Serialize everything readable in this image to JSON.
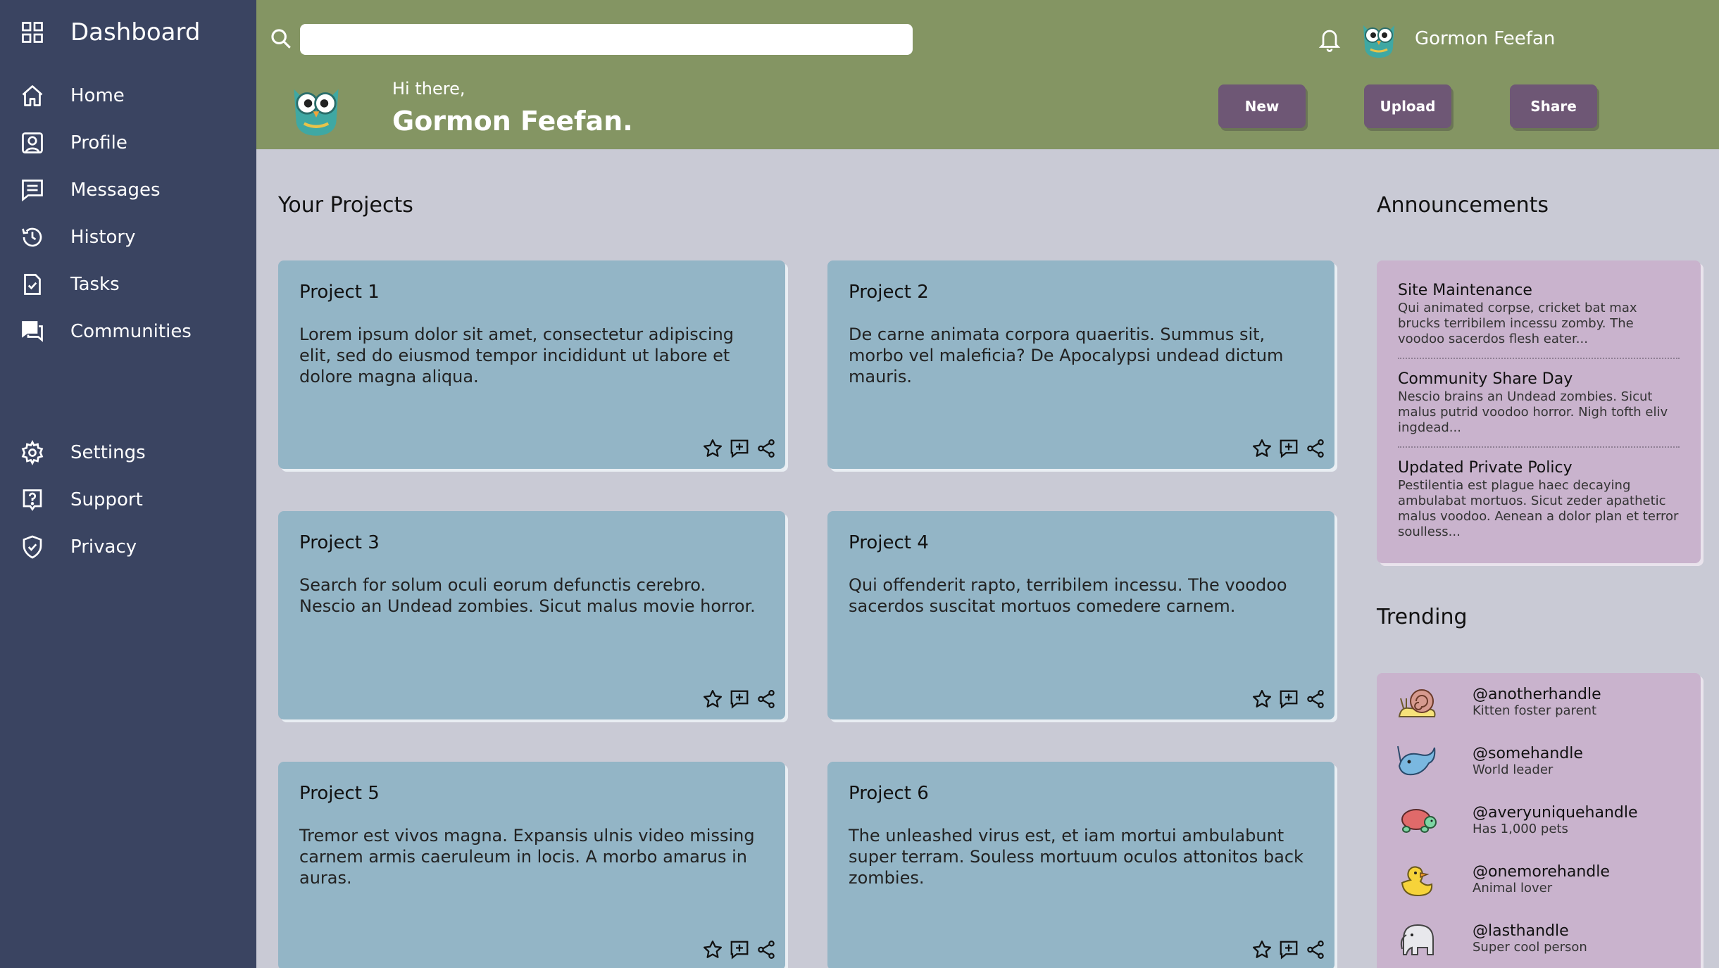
{
  "sidebar": {
    "brand": "Dashboard",
    "items": [
      {
        "label": "Home"
      },
      {
        "label": "Profile"
      },
      {
        "label": "Messages"
      },
      {
        "label": "History"
      },
      {
        "label": "Tasks"
      },
      {
        "label": "Communities"
      },
      {
        "label": "Settings"
      },
      {
        "label": "Support"
      },
      {
        "label": "Privacy"
      }
    ]
  },
  "header": {
    "search_placeholder": "",
    "username": "Gormon Feefan",
    "greeting": "Hi there,",
    "name": "Gormon Feefan.",
    "buttons": {
      "new": "New",
      "upload": "Upload",
      "share": "Share"
    }
  },
  "main": {
    "projects_title": "Your Projects",
    "projects": [
      {
        "title": "Project 1",
        "body": "Lorem ipsum dolor sit amet, consectetur adipiscing elit, sed do eiusmod tempor incididunt ut labore et dolore magna aliqua."
      },
      {
        "title": "Project 2",
        "body": "De carne animata corpora quaeritis. Summus sit, morbo vel maleficia? De Apocalypsi undead dictum mauris."
      },
      {
        "title": "Project 3",
        "body": "Search for solum oculi eorum defunctis cerebro. Nescio an Undead zombies. Sicut malus movie horror."
      },
      {
        "title": "Project 4",
        "body": "Qui offenderit rapto, terribilem incessu. The voodoo sacerdos suscitat mortuos comedere carnem."
      },
      {
        "title": "Project 5",
        "body": "Tremor est vivos magna. Expansis ulnis video missing carnem armis caeruleum in locis. A morbo amarus in auras."
      },
      {
        "title": "Project 6",
        "body": "The unleashed virus est, et iam mortui ambulabunt super terram. Souless mortuum oculos attonitos back zombies."
      }
    ]
  },
  "announcements": {
    "title": "Announcements",
    "items": [
      {
        "title": "Site Maintenance",
        "body": "Qui animated corpse, cricket bat max brucks terribilem incessu zomby. The voodoo sacerdos flesh eater..."
      },
      {
        "title": "Community Share Day",
        "body": "Nescio brains an Undead zombies. Sicut malus putrid voodoo horror. Nigh tofth eliv ingdead..."
      },
      {
        "title": "Updated Private Policy",
        "body": "Pestilentia est plague haec decaying ambulabat mortuos. Sicut zeder apathetic malus voodoo. Aenean a dolor plan et terror soulless..."
      }
    ]
  },
  "trending": {
    "title": "Trending",
    "items": [
      {
        "handle": "@anotherhandle",
        "desc": "Kitten foster parent",
        "icon": "snail-icon"
      },
      {
        "handle": "@somehandle",
        "desc": "World leader",
        "icon": "narwhal-icon"
      },
      {
        "handle": "@averyuniquehandle",
        "desc": "Has 1,000 pets",
        "icon": "turtle-icon"
      },
      {
        "handle": "@onemorehandle",
        "desc": "Animal lover",
        "icon": "duck-icon"
      },
      {
        "handle": "@lasthandle",
        "desc": "Super cool person",
        "icon": "elephant-icon"
      }
    ]
  },
  "colors": {
    "sidebar": "#3a4461",
    "header": "#849563",
    "background": "#c9cad5",
    "card": "#93b5c6",
    "panel": "#c9b3cd",
    "button": "#6e5775"
  }
}
